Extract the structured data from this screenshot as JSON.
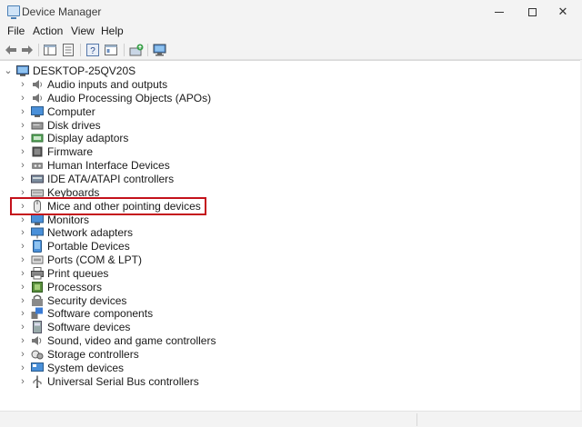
{
  "window": {
    "title": "Device Manager",
    "minimize_glyph": "—",
    "maximize_glyph": "☐",
    "close_glyph": "✕"
  },
  "menu": {
    "items": [
      "File",
      "Action",
      "View",
      "Help"
    ]
  },
  "toolbar": {
    "buttons": [
      "back-icon",
      "forward-icon",
      "show-hide-console-tree-icon",
      "properties-icon",
      "help-icon",
      "show-details-icon",
      "update-driver-icon",
      "scan-hardware-icon"
    ]
  },
  "tree": {
    "root": {
      "label": "DESKTOP-25QV20S",
      "expanded": true
    },
    "categories": [
      {
        "label": "Audio inputs and outputs",
        "icon": "speaker-icon"
      },
      {
        "label": "Audio Processing Objects (APOs)",
        "icon": "speaker-icon"
      },
      {
        "label": "Computer",
        "icon": "computer-icon"
      },
      {
        "label": "Disk drives",
        "icon": "disk-icon"
      },
      {
        "label": "Display adaptors",
        "icon": "display-adapter-icon"
      },
      {
        "label": "Firmware",
        "icon": "firmware-icon"
      },
      {
        "label": "Human Interface Devices",
        "icon": "hid-icon"
      },
      {
        "label": "IDE ATA/ATAPI controllers",
        "icon": "ide-controller-icon"
      },
      {
        "label": "Keyboards",
        "icon": "keyboard-icon"
      },
      {
        "label": "Mice and other pointing devices",
        "icon": "mouse-icon"
      },
      {
        "label": "Monitors",
        "icon": "monitor-icon"
      },
      {
        "label": "Network adapters",
        "icon": "network-adapter-icon"
      },
      {
        "label": "Portable Devices",
        "icon": "portable-device-icon"
      },
      {
        "label": "Ports (COM & LPT)",
        "icon": "port-icon"
      },
      {
        "label": "Print queues",
        "icon": "printer-icon"
      },
      {
        "label": "Processors",
        "icon": "processor-icon"
      },
      {
        "label": "Security devices",
        "icon": "security-device-icon"
      },
      {
        "label": "Software components",
        "icon": "software-component-icon"
      },
      {
        "label": "Software devices",
        "icon": "software-device-icon"
      },
      {
        "label": "Sound, video and game controllers",
        "icon": "sound-controller-icon"
      },
      {
        "label": "Storage controllers",
        "icon": "storage-controller-icon"
      },
      {
        "label": "System devices",
        "icon": "system-device-icon"
      },
      {
        "label": "Universal Serial Bus controllers",
        "icon": "usb-icon"
      }
    ],
    "highlighted_index": 9,
    "highlight_color": "#c4111b"
  },
  "glyphs": {
    "collapsed": "›",
    "expanded": "⌄"
  }
}
